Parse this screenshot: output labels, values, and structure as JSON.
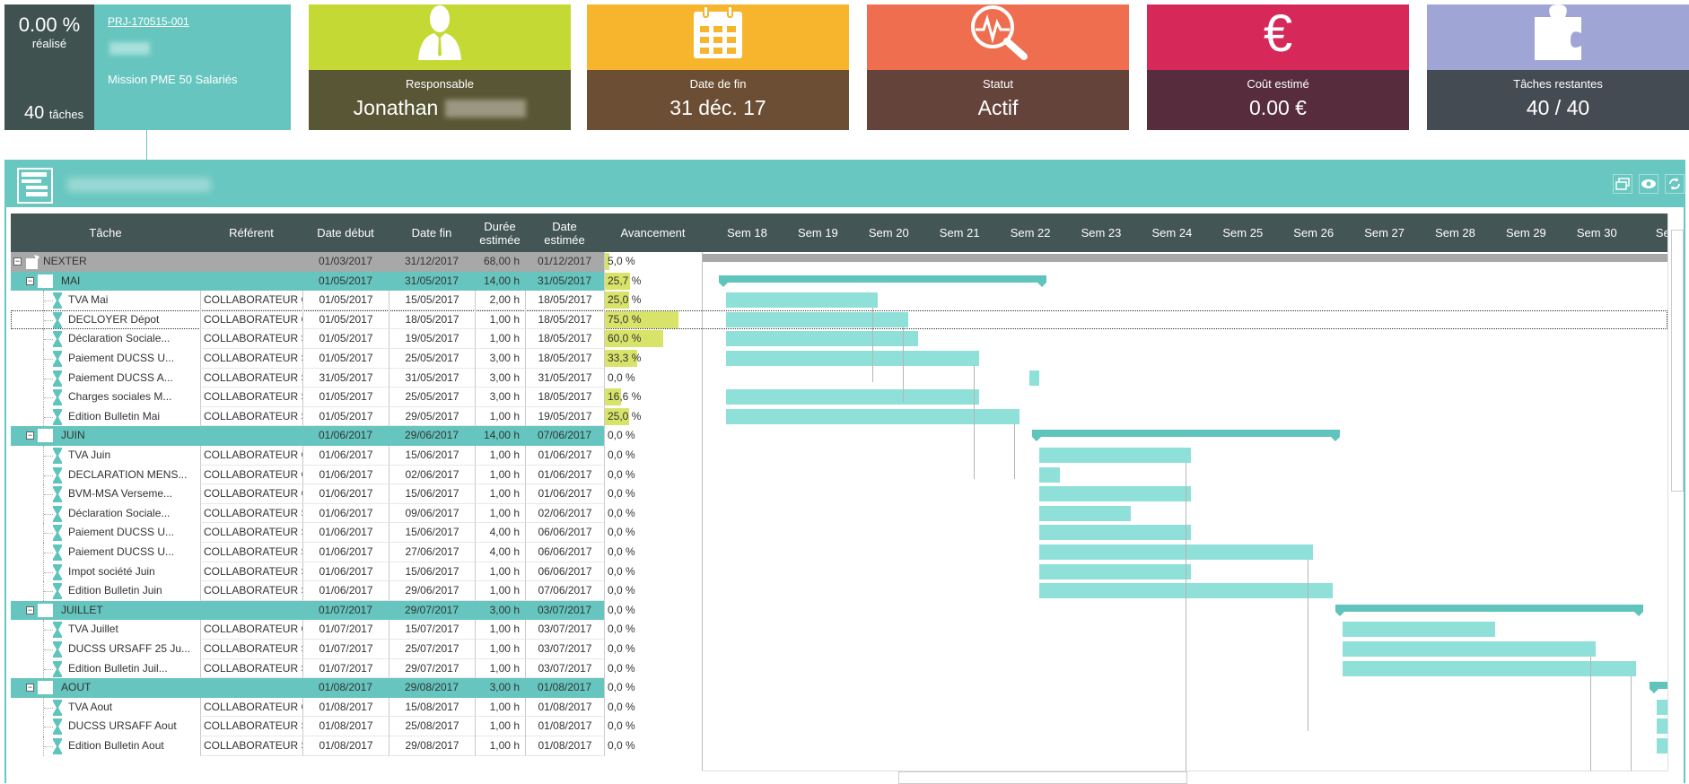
{
  "summary": {
    "percent": "0.00 %",
    "percent_label": "réalisé",
    "tasks_count": "40",
    "tasks_label": "tâches",
    "project_code": "PRJ-170515-001",
    "project_description": "Mission PME 50 Salariés"
  },
  "cards": [
    {
      "label": "Responsable",
      "value": "Jonathan",
      "icon": "person-icon",
      "top_color": "#c5d934",
      "bottom_color": "#585634"
    },
    {
      "label": "Date de fin",
      "value": "31 déc. 17",
      "icon": "calendar-icon",
      "top_color": "#f6b52c",
      "bottom_color": "#6b4e33"
    },
    {
      "label": "Statut",
      "value": "Actif",
      "icon": "pulse-search-icon",
      "top_color": "#ee6e4f",
      "bottom_color": "#64433a"
    },
    {
      "label": "Coût estimé",
      "value": "0.00 €",
      "icon": "euro-icon",
      "top_color": "#d7285a",
      "bottom_color": "#572c3c"
    },
    {
      "label": "Tâches restantes",
      "value": "40 / 40",
      "icon": "puzzle-icon",
      "top_color": "#9fa6d6",
      "bottom_color": "#454b52"
    }
  ],
  "gantt": {
    "columns": [
      "Tâche",
      "Référent",
      "Date début",
      "Date fin",
      "Durée estimée",
      "Date estimée",
      "Avancement"
    ],
    "weeks": [
      "Sem 18",
      "Sem 19",
      "Sem 20",
      "Sem 21",
      "Sem 22",
      "Sem 23",
      "Sem 24",
      "Sem 25",
      "Sem 26",
      "Sem 27",
      "Sem 28",
      "Sem 29",
      "Sem 30",
      "Sem"
    ],
    "colors": {
      "header": "#435554",
      "panel": "#68c7c0",
      "task_bar": "#8fe0d9",
      "summary_bar": "#5fc4bb",
      "root_bar": "#a8a8a8",
      "progress": "#d8e36a"
    },
    "rows": [
      {
        "type": "root",
        "name": "NEXTER",
        "ref": "",
        "start": "01/03/2017",
        "end": "31/12/2017",
        "dur": "68,00 h",
        "est": "01/12/2017",
        "pct_text": "5,0 %",
        "pct": 5
      },
      {
        "type": "group",
        "name": "MAI",
        "ref": "",
        "start": "01/05/2017",
        "end": "31/05/2017",
        "dur": "14,00 h",
        "est": "31/05/2017",
        "pct_text": "25,7 %",
        "pct": 25.7
      },
      {
        "type": "task",
        "name": "TVA Mai",
        "ref": "COLLABORATEUR C",
        "start": "01/05/2017",
        "end": "15/05/2017",
        "dur": "2,00 h",
        "est": "18/05/2017",
        "pct_text": "25,0 %",
        "pct": 25
      },
      {
        "type": "task",
        "name": "DECLOYER Dépot",
        "ref": "COLLABORATEUR C",
        "start": "01/05/2017",
        "end": "18/05/2017",
        "dur": "1,00 h",
        "est": "18/05/2017",
        "pct_text": "75,0 %",
        "pct": 75,
        "selected": true
      },
      {
        "type": "task",
        "name": "Déclaration Sociale...",
        "ref": "COLLABORATEUR S",
        "start": "01/05/2017",
        "end": "19/05/2017",
        "dur": "1,00 h",
        "est": "18/05/2017",
        "pct_text": "60,0 %",
        "pct": 60
      },
      {
        "type": "task",
        "name": "Paiement DUCSS U...",
        "ref": "COLLABORATEUR S",
        "start": "01/05/2017",
        "end": "25/05/2017",
        "dur": "3,00 h",
        "est": "18/05/2017",
        "pct_text": "33,3 %",
        "pct": 33.3
      },
      {
        "type": "task",
        "name": "Paiement DUCSS A...",
        "ref": "COLLABORATEUR S",
        "start": "31/05/2017",
        "end": "31/05/2017",
        "dur": "3,00 h",
        "est": "31/05/2017",
        "pct_text": "0,0 %",
        "pct": 0
      },
      {
        "type": "task",
        "name": "Charges sociales M...",
        "ref": "COLLABORATEUR S",
        "start": "01/05/2017",
        "end": "25/05/2017",
        "dur": "3,00 h",
        "est": "18/05/2017",
        "pct_text": "16,6 %",
        "pct": 16.6
      },
      {
        "type": "task",
        "name": "Edition Bulletin Mai",
        "ref": "COLLABORATEUR S",
        "start": "01/05/2017",
        "end": "29/05/2017",
        "dur": "1,00 h",
        "est": "19/05/2017",
        "pct_text": "25,0 %",
        "pct": 25
      },
      {
        "type": "group",
        "name": "JUIN",
        "ref": "",
        "start": "01/06/2017",
        "end": "29/06/2017",
        "dur": "14,00 h",
        "est": "07/06/2017",
        "pct_text": "0,0 %",
        "pct": 0
      },
      {
        "type": "task",
        "name": "TVA Juin",
        "ref": "COLLABORATEUR C",
        "start": "01/06/2017",
        "end": "15/06/2017",
        "dur": "1,00 h",
        "est": "01/06/2017",
        "pct_text": "0,0 %",
        "pct": 0
      },
      {
        "type": "task",
        "name": "DECLARATION MENS...",
        "ref": "COLLABORATEUR C",
        "start": "01/06/2017",
        "end": "02/06/2017",
        "dur": "1,00 h",
        "est": "01/06/2017",
        "pct_text": "0,0 %",
        "pct": 0
      },
      {
        "type": "task",
        "name": "BVM-MSA Verseme...",
        "ref": "COLLABORATEUR C",
        "start": "01/06/2017",
        "end": "15/06/2017",
        "dur": "1,00 h",
        "est": "01/06/2017",
        "pct_text": "0,0 %",
        "pct": 0
      },
      {
        "type": "task",
        "name": "Déclaration Sociale...",
        "ref": "COLLABORATEUR S",
        "start": "01/06/2017",
        "end": "09/06/2017",
        "dur": "1,00 h",
        "est": "02/06/2017",
        "pct_text": "0,0 %",
        "pct": 0
      },
      {
        "type": "task",
        "name": "Paiement DUCSS U...",
        "ref": "COLLABORATEUR S",
        "start": "01/06/2017",
        "end": "15/06/2017",
        "dur": "4,00 h",
        "est": "06/06/2017",
        "pct_text": "0,0 %",
        "pct": 0
      },
      {
        "type": "task",
        "name": "Paiement DUCSS U...",
        "ref": "COLLABORATEUR S",
        "start": "01/06/2017",
        "end": "27/06/2017",
        "dur": "4,00 h",
        "est": "06/06/2017",
        "pct_text": "0,0 %",
        "pct": 0
      },
      {
        "type": "task",
        "name": "Impot société Juin",
        "ref": "COLLABORATEUR S",
        "start": "01/06/2017",
        "end": "15/06/2017",
        "dur": "1,00 h",
        "est": "06/06/2017",
        "pct_text": "0,0 %",
        "pct": 0
      },
      {
        "type": "task",
        "name": "Edition Bulletin Juin",
        "ref": "COLLABORATEUR S",
        "start": "01/06/2017",
        "end": "29/06/2017",
        "dur": "1,00 h",
        "est": "07/06/2017",
        "pct_text": "0,0 %",
        "pct": 0
      },
      {
        "type": "group",
        "name": "JUILLET",
        "ref": "",
        "start": "01/07/2017",
        "end": "29/07/2017",
        "dur": "3,00 h",
        "est": "03/07/2017",
        "pct_text": "0,0 %",
        "pct": 0
      },
      {
        "type": "task",
        "name": "TVA Juillet",
        "ref": "COLLABORATEUR C",
        "start": "01/07/2017",
        "end": "15/07/2017",
        "dur": "1,00 h",
        "est": "03/07/2017",
        "pct_text": "0,0 %",
        "pct": 0
      },
      {
        "type": "task",
        "name": "DUCSS URSAFF 25 Ju...",
        "ref": "COLLABORATEUR S",
        "start": "01/07/2017",
        "end": "25/07/2017",
        "dur": "1,00 h",
        "est": "03/07/2017",
        "pct_text": "0,0 %",
        "pct": 0
      },
      {
        "type": "task",
        "name": "Edition Bulletin Juil...",
        "ref": "COLLABORATEUR S",
        "start": "01/07/2017",
        "end": "29/07/2017",
        "dur": "1,00 h",
        "est": "03/07/2017",
        "pct_text": "0,0 %",
        "pct": 0
      },
      {
        "type": "group",
        "name": "AOUT",
        "ref": "",
        "start": "01/08/2017",
        "end": "29/08/2017",
        "dur": "3,00 h",
        "est": "01/08/2017",
        "pct_text": "0,0 %",
        "pct": 0
      },
      {
        "type": "task",
        "name": "TVA Aout",
        "ref": "COLLABORATEUR C",
        "start": "01/08/2017",
        "end": "15/08/2017",
        "dur": "1,00 h",
        "est": "01/08/2017",
        "pct_text": "0,0 %",
        "pct": 0
      },
      {
        "type": "task",
        "name": "DUCSS URSAFF Aout",
        "ref": "COLLABORATEUR S",
        "start": "01/08/2017",
        "end": "25/08/2017",
        "dur": "1,00 h",
        "est": "01/08/2017",
        "pct_text": "0,0 %",
        "pct": 0
      },
      {
        "type": "task",
        "name": "Edition Bulletin Aout",
        "ref": "COLLABORATEUR S",
        "start": "01/08/2017",
        "end": "29/08/2017",
        "dur": "1,00 h",
        "est": "01/08/2017",
        "pct_text": "0,0 %",
        "pct": 0
      }
    ]
  }
}
